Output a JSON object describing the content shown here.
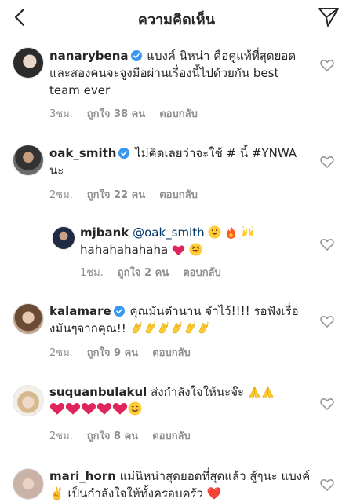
{
  "header": {
    "title": "ความคิดเห็น"
  },
  "comments": [
    {
      "username": "nanarybena",
      "verified": true,
      "text": "แบงค์ นิหน่า คือคู่แท้ที่สุดยอด และสองคนจะจูงมือผ่านเรื่องนี้ไปด้วยกัน best team ever",
      "time": "3ชม.",
      "likes": "ถูกใจ 38 คน",
      "reply": "ตอบกลับ"
    },
    {
      "username": "oak_smith",
      "verified": true,
      "text": "ไม่คิดเลยว่าจะใช้ # นี้ #YNWA นะ",
      "time": "2ชม.",
      "likes": "ถูกใจ 22 คน",
      "reply": "ตอบกลับ"
    },
    {
      "username": "mjbank",
      "verified": false,
      "mention": "@oak_smith",
      "text": "hahahahahaha",
      "time": "1ชม.",
      "likes": "ถูกใจ 2 คน",
      "reply": "ตอบกลับ"
    },
    {
      "username": "kalamare",
      "verified": true,
      "text": "คุณมันตำนาน จำไว้!!!! รอฟังเรื่องมันๆจากคุณ!!",
      "time": "2ชม.",
      "likes": "ถูกใจ 9 คน",
      "reply": "ตอบกลับ"
    },
    {
      "username": "suquanbulakul",
      "verified": false,
      "text": "ส่งกำลังใจให้นะจ๊ะ",
      "time": "2ชม.",
      "likes": "ถูกใจ 8 คน",
      "reply": "ตอบกลับ"
    },
    {
      "username": "mari_horn",
      "verified": false,
      "text": "แม่นิหน่าสุดยอดที่สุดแล้ว สู้ๆนะ แบงค์ ✌️ เป็นกำลังใจให้ทั้งครอบครัว ❤️"
    }
  ]
}
